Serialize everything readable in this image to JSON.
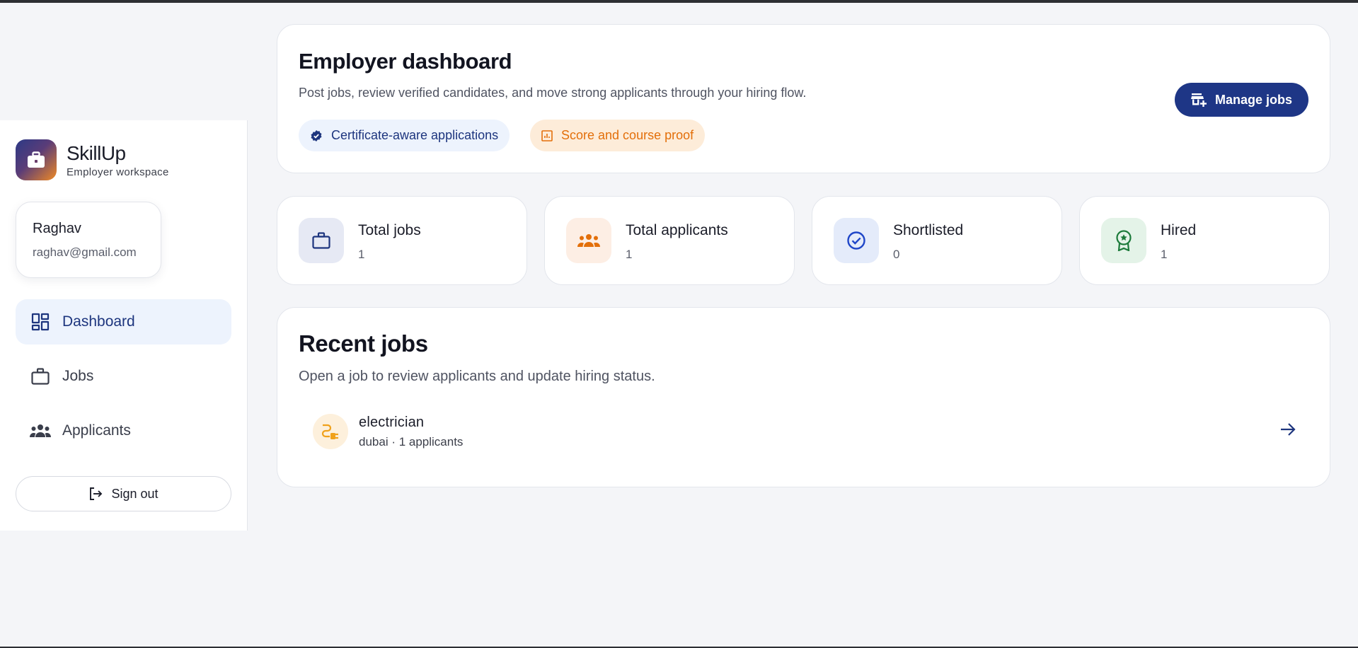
{
  "sidebar": {
    "brand": {
      "name": "SkillUp",
      "subtitle": "Employer workspace",
      "logo_icon": "briefcase-icon"
    },
    "user": {
      "name": "Raghav",
      "email": "raghav@gmail.com"
    },
    "nav": [
      {
        "label": "Dashboard",
        "icon": "dashboard-icon",
        "active": true
      },
      {
        "label": "Jobs",
        "icon": "briefcase-icon",
        "active": false
      },
      {
        "label": "Applicants",
        "icon": "group-icon",
        "active": false
      }
    ],
    "sign_out_label": "Sign out"
  },
  "hero": {
    "title": "Employer dashboard",
    "description": "Post jobs, review verified candidates, and move strong applicants through your hiring flow.",
    "chips": [
      {
        "label": "Certificate-aware applications",
        "icon": "verified-icon"
      },
      {
        "label": "Score and course proof",
        "icon": "analytics-icon"
      }
    ],
    "manage_button_label": "Manage jobs"
  },
  "stats": [
    {
      "label": "Total jobs",
      "value": "1",
      "icon": "briefcase-icon"
    },
    {
      "label": "Total applicants",
      "value": "1",
      "icon": "groups-icon"
    },
    {
      "label": "Shortlisted",
      "value": "0",
      "icon": "check-circle-icon"
    },
    {
      "label": "Hired",
      "value": "1",
      "icon": "award-icon"
    }
  ],
  "recent_jobs": {
    "title": "Recent jobs",
    "description": "Open a job to review applicants and update hiring status.",
    "items": [
      {
        "title": "electrician",
        "meta": "dubai · 1 applicants",
        "icon": "plug-icon"
      }
    ]
  },
  "colors": {
    "primary": "#1e3686",
    "accent_orange": "#e36f0a",
    "active_nav_bg": "#edf3fd",
    "page_bg": "#f4f5f8"
  }
}
